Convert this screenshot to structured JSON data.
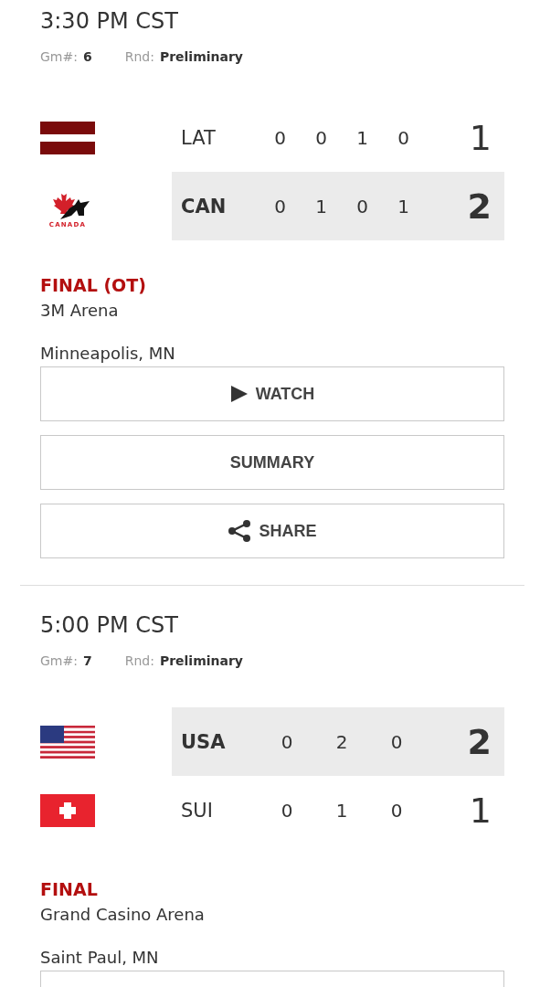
{
  "games": [
    {
      "time": "3:30 PM CST",
      "game_label": "Gm#:",
      "game_number": "6",
      "round_label": "Rnd:",
      "round": "Preliminary",
      "teams": [
        {
          "kind": "latvia",
          "abbr": "LAT",
          "periods": [
            "0",
            "0",
            "1",
            "0"
          ],
          "total": "1",
          "winner": false
        },
        {
          "kind": "canada",
          "logo_text": "CANADA",
          "abbr": "CAN",
          "periods": [
            "0",
            "1",
            "0",
            "1"
          ],
          "total": "2",
          "winner": true
        }
      ],
      "status": "FINAL (OT)",
      "arena": "3M Arena",
      "city": "Minneapolis, MN",
      "buttons": [
        {
          "kind": "watch",
          "label": "WATCH"
        },
        {
          "kind": "summary",
          "label": "SUMMARY"
        },
        {
          "kind": "share",
          "label": "SHARE"
        }
      ]
    },
    {
      "time": "5:00 PM CST",
      "game_label": "Gm#:",
      "game_number": "7",
      "round_label": "Rnd:",
      "round": "Preliminary",
      "teams": [
        {
          "kind": "usa",
          "abbr": "USA",
          "periods": [
            "0",
            "2",
            "0"
          ],
          "total": "2",
          "winner": true
        },
        {
          "kind": "switzerland",
          "abbr": "SUI",
          "periods": [
            "0",
            "1",
            "0"
          ],
          "total": "1",
          "winner": false
        }
      ],
      "status": "FINAL",
      "arena": "Grand Casino Arena",
      "city": "Saint Paul, MN",
      "buttons_cut_off": true
    }
  ]
}
